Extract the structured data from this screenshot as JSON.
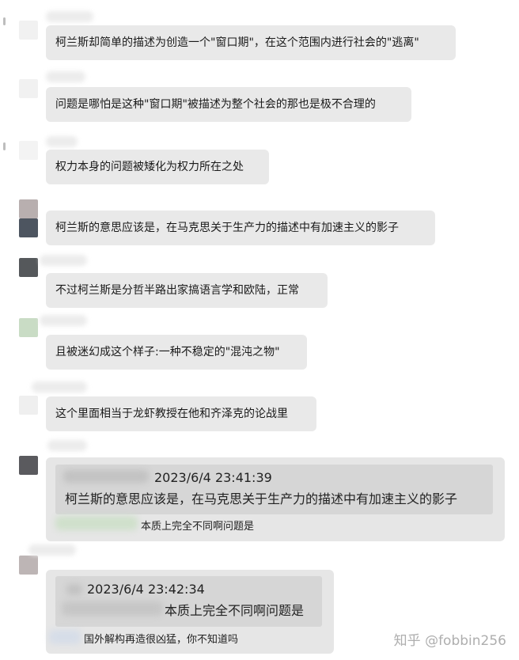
{
  "messages": [
    {
      "text": "柯兰斯却简单的描述为创造一个\"窗口期\"，在这个范围内进行社会的\"逃离\"",
      "avatar_color": "#f1f1f1"
    },
    {
      "text": "问题是哪怕是这种\"窗口期\"被描述为整个社会的那也是极不合理的",
      "avatar_color": "#f1f1f1"
    },
    {
      "text": "权力本身的问题被矮化为权力所在之处",
      "avatar_color": "#f3f3f3"
    },
    {
      "text": "柯兰斯的意思应该是，在马克思关于生产力的描述中有加速主义的影子",
      "avatar_color": "#b8afaf"
    },
    {
      "text": "不过柯兰斯是分哲半路出家搞语言学和欧陆，正常",
      "avatar_color": "#55585b"
    },
    {
      "text": "且被迷幻成这个样子:一种不稳定的\"混沌之物\"",
      "avatar_color": "#c9dcc5"
    },
    {
      "text": "这个里面相当于龙虾教授在他和齐泽克的论战里",
      "avatar_color": "#efefef"
    }
  ],
  "quotes": [
    {
      "timestamp": "2023/6/4 23:41:39",
      "quoted_text": "柯兰斯的意思应该是，在马克思关于生产力的描述中有加速主义的影子",
      "reply": "本质上完全不同啊问题是",
      "avatar_color": "#5a5a5e"
    },
    {
      "timestamp": "2023/6/4 23:42:34",
      "quoted_text": "本质上完全不同啊问题是",
      "reply": "国外解构再造很凶猛，你不知道吗",
      "avatar_color": "#bdb5b5"
    }
  ],
  "watermark": "知乎 @fobbin256"
}
